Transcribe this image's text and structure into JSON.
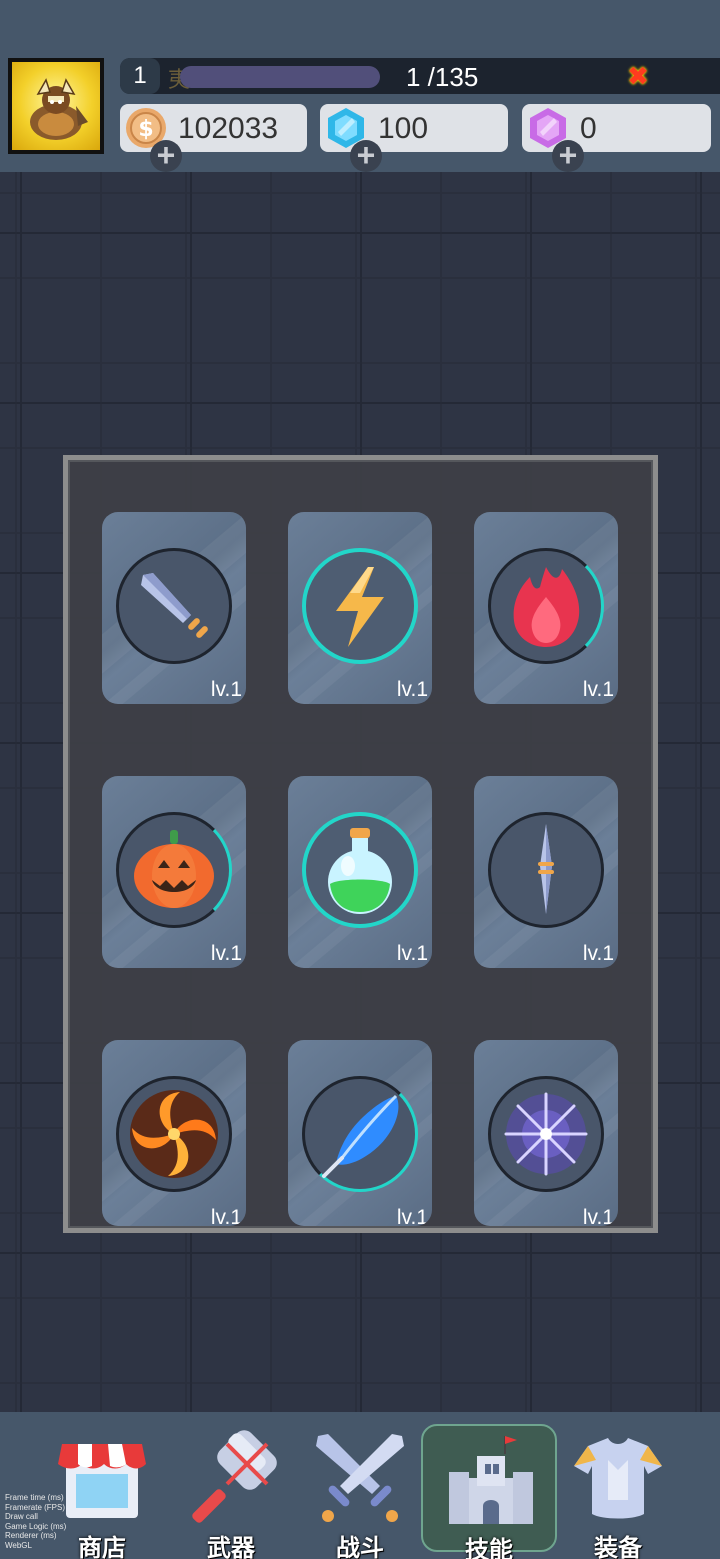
{
  "header": {
    "level": "1",
    "xp_faded_text": "夷",
    "xp_text": "1 /135",
    "close_icon": "close-x-icon",
    "currencies": [
      {
        "name": "coin",
        "value": "102033",
        "color": "#e9a86a"
      },
      {
        "name": "diamond",
        "value": "100",
        "color": "#2fb7e8"
      },
      {
        "name": "gem",
        "value": "0",
        "color": "#c86be6"
      }
    ]
  },
  "skills": [
    {
      "icon": "sword-icon",
      "level": "lv.1"
    },
    {
      "icon": "lightning-icon",
      "level": "lv.1",
      "active": true
    },
    {
      "icon": "flame-icon",
      "level": "lv.1"
    },
    {
      "icon": "pumpkin-icon",
      "level": "lv.1"
    },
    {
      "icon": "potion-icon",
      "level": "lv.1",
      "active": true
    },
    {
      "icon": "dart-icon",
      "level": "lv.1"
    },
    {
      "icon": "fire-vortex-icon",
      "level": "lv.1"
    },
    {
      "icon": "feather-icon",
      "level": "lv.1"
    },
    {
      "icon": "starburst-icon",
      "level": "lv.1"
    }
  ],
  "nav": [
    {
      "label": "商店",
      "icon": "shop-icon"
    },
    {
      "label": "武器",
      "icon": "hammer-icon"
    },
    {
      "label": "战斗",
      "icon": "crossed-swords-icon"
    },
    {
      "label": "技能",
      "icon": "castle-icon",
      "active": true
    },
    {
      "label": "装备",
      "icon": "armor-icon"
    }
  ],
  "debug_lines": [
    "Frame time (ms)",
    "Framerate (FPS)",
    "Draw call",
    "Game Logic (ms)",
    "Renderer (ms)",
    "WebGL"
  ]
}
